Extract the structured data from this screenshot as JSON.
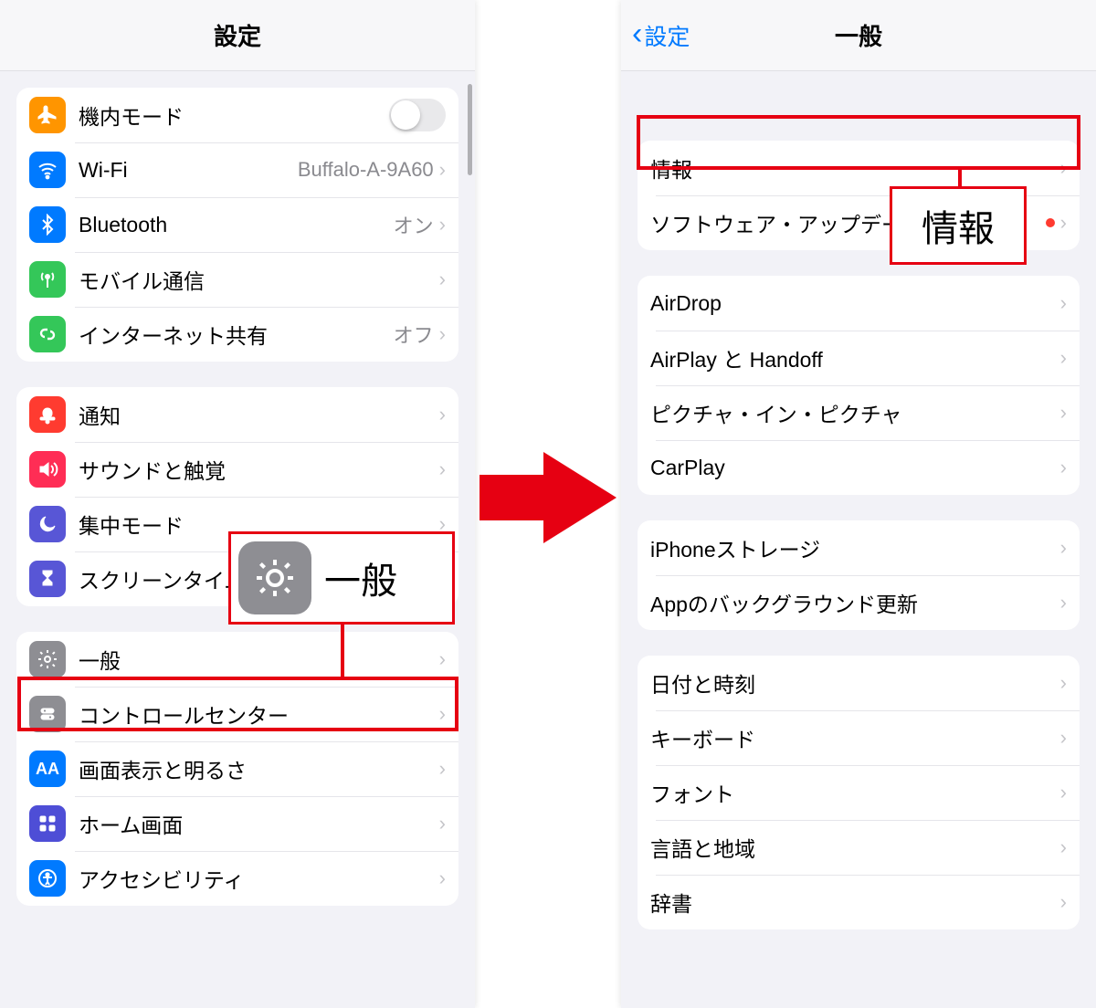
{
  "colors": {
    "highlight": "#e60012",
    "link": "#007aff"
  },
  "arrow": {
    "label": "→"
  },
  "left": {
    "title": "設定",
    "groups": [
      {
        "rows": [
          {
            "key": "airplane",
            "icon": "airplane-icon",
            "label": "機内モード",
            "toggle": false
          },
          {
            "key": "wifi",
            "icon": "wifi-icon",
            "label": "Wi-Fi",
            "value": "Buffalo-A-9A60",
            "chevron": true
          },
          {
            "key": "bluetooth",
            "icon": "bluetooth-icon",
            "label": "Bluetooth",
            "value": "オン",
            "chevron": true
          },
          {
            "key": "cellular",
            "icon": "antenna-icon",
            "label": "モバイル通信",
            "chevron": true
          },
          {
            "key": "hotspot",
            "icon": "link-icon",
            "label": "インターネット共有",
            "value": "オフ",
            "chevron": true
          }
        ]
      },
      {
        "rows": [
          {
            "key": "notifications",
            "icon": "bell-icon",
            "label": "通知",
            "chevron": true
          },
          {
            "key": "sounds",
            "icon": "speaker-icon",
            "label": "サウンドと触覚",
            "chevron": true
          },
          {
            "key": "focus",
            "icon": "moon-icon",
            "label": "集中モード",
            "chevron": true
          },
          {
            "key": "screentime",
            "icon": "hourglass-icon",
            "label": "スクリーンタイム",
            "chevron": true
          }
        ]
      },
      {
        "rows": [
          {
            "key": "general",
            "icon": "gear-icon",
            "label": "一般",
            "chevron": true
          },
          {
            "key": "controlcenter",
            "icon": "switches-icon",
            "label": "コントロールセンター",
            "chevron": true
          },
          {
            "key": "display",
            "icon": "aa-icon",
            "label": "画面表示と明るさ",
            "chevron": true
          },
          {
            "key": "home",
            "icon": "grid-icon",
            "label": "ホーム画面",
            "chevron": true
          },
          {
            "key": "accessibility",
            "icon": "accessibility-icon",
            "label": "アクセシビリティ",
            "chevron": true
          }
        ]
      }
    ],
    "callout": {
      "icon": "gear-icon",
      "text": "一般"
    }
  },
  "right": {
    "back": "設定",
    "title": "一般",
    "groups": [
      {
        "rows": [
          {
            "key": "about",
            "label": "情報",
            "chevron": true
          },
          {
            "key": "swupdate",
            "label": "ソフトウェア・アップデート",
            "badge": true,
            "chevron": true
          }
        ]
      },
      {
        "rows": [
          {
            "key": "airdrop",
            "label": "AirDrop",
            "chevron": true
          },
          {
            "key": "airplay",
            "label": "AirPlay と Handoff",
            "chevron": true
          },
          {
            "key": "pip",
            "label": "ピクチャ・イン・ピクチャ",
            "chevron": true
          },
          {
            "key": "carplay",
            "label": "CarPlay",
            "chevron": true
          }
        ]
      },
      {
        "rows": [
          {
            "key": "storage",
            "label": "iPhoneストレージ",
            "chevron": true
          },
          {
            "key": "bgrefresh",
            "label": "Appのバックグラウンド更新",
            "chevron": true
          }
        ]
      },
      {
        "rows": [
          {
            "key": "datetime",
            "label": "日付と時刻",
            "chevron": true
          },
          {
            "key": "keyboard",
            "label": "キーボード",
            "chevron": true
          },
          {
            "key": "fonts",
            "label": "フォント",
            "chevron": true
          },
          {
            "key": "language",
            "label": "言語と地域",
            "chevron": true
          },
          {
            "key": "dictionary",
            "label": "辞書",
            "chevron": true
          }
        ]
      }
    ],
    "callout": {
      "text": "情報"
    }
  }
}
